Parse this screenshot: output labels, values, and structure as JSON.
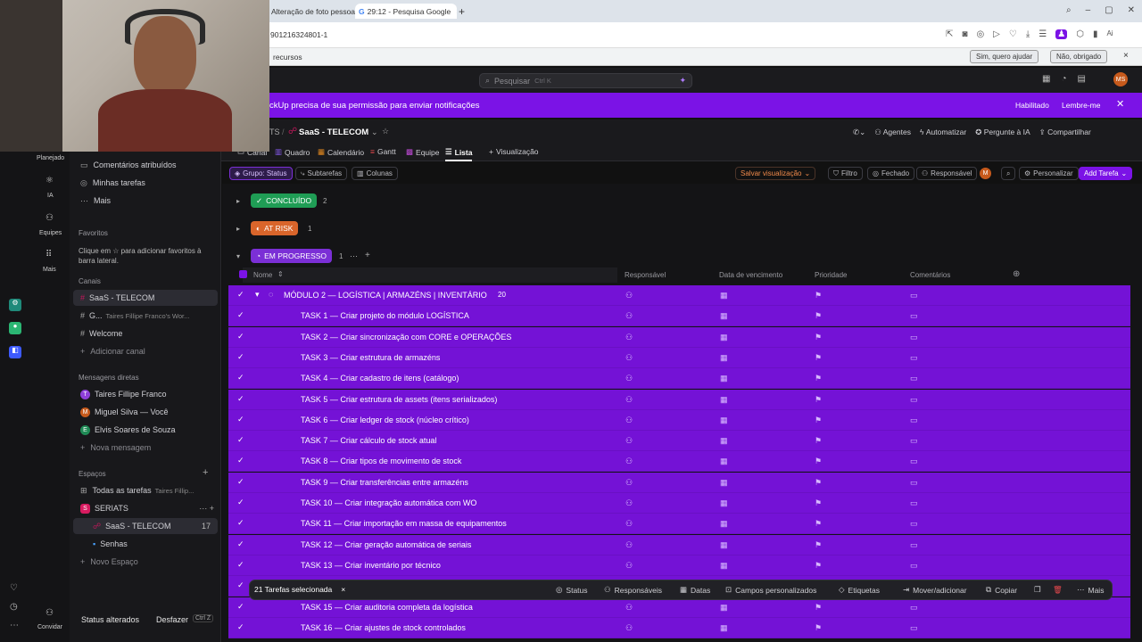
{
  "browser": {
    "tabs": [
      {
        "label": "Alteração de foto pessoa"
      },
      {
        "label": "29:12 - Pesquisa Google"
      }
    ],
    "new_tab": "+",
    "url": "901216324801-1",
    "infobar_text": "recursos",
    "infobar_yes": "Sim, quero ajudar",
    "infobar_no": "Não, obrigado",
    "infobar_close": "×",
    "profile_badge": "Ai"
  },
  "app": {
    "search_placeholder": "Pesquisar",
    "search_shortcut": "Ctrl K",
    "avatar_initials": "MS",
    "notification": {
      "text": "ckUp precisa de sua permissão para enviar notificações",
      "enable": "Habilitado",
      "remind": "Lembre-me"
    },
    "breadcrumb": {
      "prefix": "TS",
      "space": "SaaS - TELECOM"
    },
    "header_actions": {
      "agents": "Agentes",
      "automate": "Automatizar",
      "ask_ai": "Pergunte à IA",
      "share": "Compartilhar"
    },
    "views": {
      "canal": "Canal",
      "quadro": "Quadro",
      "calendario": "Calendário",
      "gantt": "Gantt",
      "equipe": "Equipe",
      "lista": "Lista",
      "add_view": "Visualização"
    },
    "filters": {
      "group": "Grupo: Status",
      "subtasks": "Subtarefas",
      "columns": "Colunas",
      "save_view": "Salvar visualização",
      "filter": "Filtro",
      "closed": "Fechado",
      "assignee": "Responsável",
      "assignee_avatar": "M",
      "customize": "Personalizar",
      "add_task": "Add Tarefa"
    }
  },
  "left_rail": {
    "planned": "Planejado",
    "ai": "IA",
    "teams": "Equipes",
    "more": "Mais",
    "invite": "Convidar"
  },
  "sidebar": {
    "top_items": [
      "Comentários atribuídos",
      "Minhas tarefas",
      "Mais"
    ],
    "favorites_header": "Favoritos",
    "favorites_hint_1": "Clique em",
    "favorites_hint_2": "para adicionar favoritos à barra lateral.",
    "channels_header": "Canais",
    "channels": [
      {
        "label": "SaaS - TELECOM",
        "active": true
      },
      {
        "label": "G...",
        "sub": "Taires Fillipe Franco's Wor..."
      },
      {
        "label": "Welcome"
      }
    ],
    "add_channel": "Adicionar canal",
    "dm_header": "Mensagens diretas",
    "dms": [
      {
        "initial": "T",
        "name": "Taires Fillipe Franco",
        "color": "#8e3fd9"
      },
      {
        "initial": "M",
        "name": "Miguel Silva  — Você",
        "color": "#c75a1c"
      },
      {
        "initial": "E",
        "name": "Elvis Soares de Souza",
        "color": "#1f8a55"
      }
    ],
    "new_message": "Nova mensagem",
    "spaces_header": "Espaços",
    "all_tasks": "Todas as tarefas",
    "all_tasks_sub": "Taires Fillip...",
    "space_name": "SERIATS",
    "space_initial": "S",
    "space_lists": [
      {
        "label": "SaaS - TELECOM",
        "count": "17",
        "active": true
      },
      {
        "label": "Senhas",
        "count": ""
      }
    ],
    "new_space": "Novo Espaço",
    "status_changed": "Status alterados",
    "undo": "Desfazer",
    "undo_shortcut": "Ctrl Z"
  },
  "list": {
    "groups": [
      {
        "label": "CONCLUÍDO",
        "count": "2",
        "color": "#1f9d55"
      },
      {
        "label": "AT RISK",
        "count": "1",
        "color": "#d9652b"
      },
      {
        "label": "EM PROGRESSO",
        "count": "1",
        "color": "#7b2fd6"
      }
    ],
    "columns": {
      "name": "Nome",
      "assignee": "Responsável",
      "due": "Data de vencimento",
      "priority": "Prioridade",
      "comments": "Comentários"
    },
    "parent_task": {
      "name": "MÓDULO 2 — LOGÍSTICA | ARMAZÉNS | INVENTÁRIO",
      "subtasks": "20"
    },
    "tasks": [
      "TASK 1 — Criar projeto do módulo LOGÍSTICA",
      "TASK 2 — Criar sincronização com CORE e OPERAÇÕES",
      "TASK 3 — Criar estrutura de armazéns",
      "TASK 4 — Criar cadastro de itens (catálogo)",
      "TASK 5 — Criar estrutura de assets (itens serializados)",
      "TASK 6 — Criar ledger de stock (núcleo crítico)",
      "TASK 7 — Criar cálculo de stock atual",
      "TASK 8 — Criar tipos de movimento de stock",
      "TASK 9 — Criar transferências entre armazéns",
      "TASK 10 — Criar integração automática com WO",
      "TASK 11 — Criar importação em massa de equipamentos",
      "TASK 12 — Criar geração automática de seriais",
      "TASK 13 — Criar inventário por técnico",
      "",
      "TASK 15 — Criar auditoria completa da logística",
      "TASK 16 — Criar ajustes de stock controlados"
    ],
    "selection_bar": {
      "count": "21 Tarefas selecionada",
      "status": "Status",
      "assignees": "Responsáveis",
      "dates": "Datas",
      "custom_fields": "Campos personalizados",
      "tags": "Etiquetas",
      "move": "Mover/adicionar",
      "copy": "Copiar",
      "more": "Mais"
    }
  }
}
